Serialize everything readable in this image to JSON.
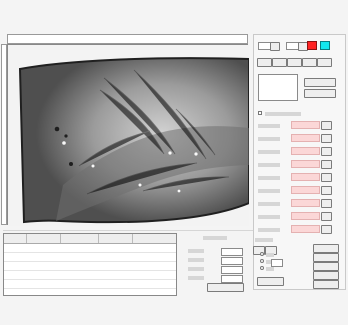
{
  "colors": {
    "marker_red": "#ff2222",
    "marker_cyan": "#12e6ee",
    "result_field_fill": "#fbd7d7"
  },
  "icons": [
    "image-viewer",
    "dropdown-arrow-icon",
    "color-swatch-icon"
  ],
  "top_ruler": {
    "tick_labels": []
  },
  "left_ruler": {
    "tick_labels": []
  },
  "table": {
    "headers": [],
    "rows": []
  },
  "right_panel": {
    "labels": [],
    "buttons": [],
    "dropdown": {
      "value": ""
    },
    "list_box": {
      "items": []
    }
  },
  "bottom_controls": {
    "labels": [],
    "values": [],
    "buttons": []
  }
}
